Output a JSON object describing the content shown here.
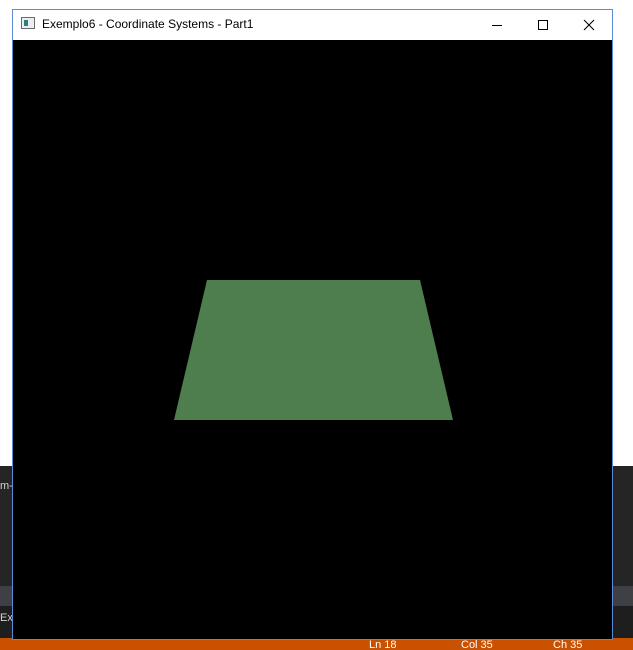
{
  "window": {
    "title": "Exemplo6 - Coordinate Systems - Part1",
    "controls": {
      "minimize": "minimize-icon",
      "maximize": "maximize-icon",
      "close": "close-icon"
    }
  },
  "viewport": {
    "background_color": "#000000",
    "shape_color": "#4e7d4e"
  },
  "background_editor": {
    "panel_fragment": "m-",
    "output_fragment": "Ex",
    "status": {
      "line": "Ln 18",
      "column": "Col 35",
      "char": "Ch 35"
    },
    "status_color": "#ca5100"
  }
}
